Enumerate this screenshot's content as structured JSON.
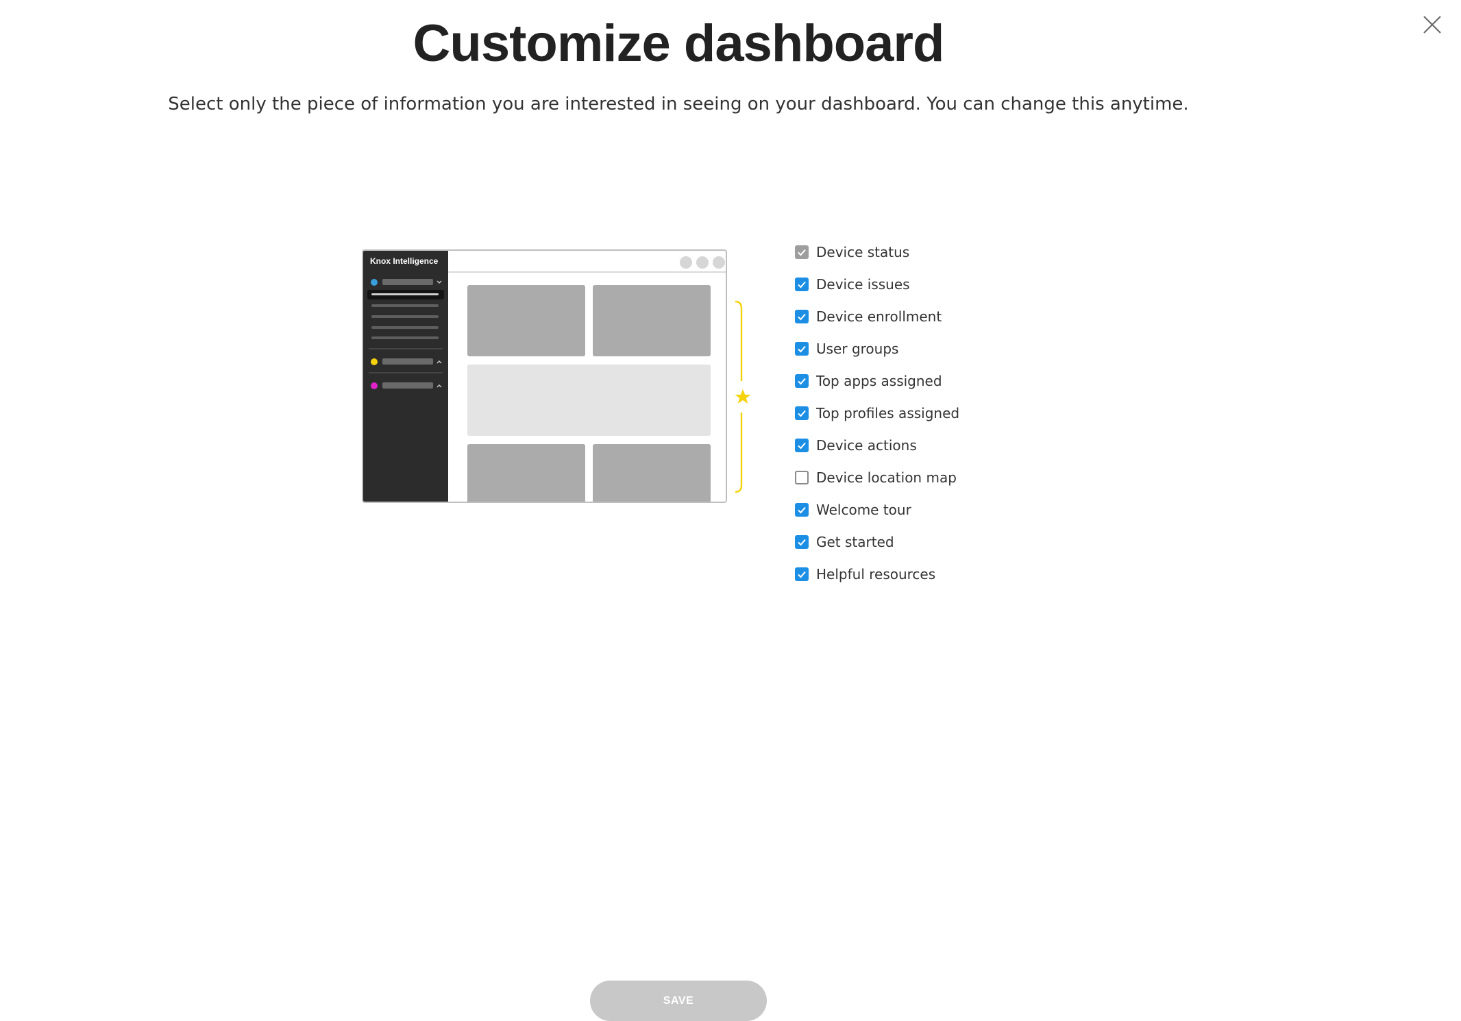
{
  "dialog": {
    "title": "Customize dashboard",
    "subtitle": "Select only the piece of information you are interested in seeing on your dashboard. You can change this anytime.",
    "close_icon": "close-icon"
  },
  "illustration": {
    "brand_label": "Knox Intelligence",
    "accent_colors": {
      "blue": "#3aa0dc",
      "yellow": "#f5d20a",
      "magenta": "#e023c8",
      "star": "#f5d20a"
    }
  },
  "options": [
    {
      "label": "Device status",
      "state": "checked-disabled"
    },
    {
      "label": "Device issues",
      "state": "checked"
    },
    {
      "label": "Device enrollment",
      "state": "checked"
    },
    {
      "label": "User groups",
      "state": "checked"
    },
    {
      "label": "Top apps assigned",
      "state": "checked"
    },
    {
      "label": "Top profiles assigned",
      "state": "checked"
    },
    {
      "label": "Device actions",
      "state": "checked"
    },
    {
      "label": "Device location map",
      "state": "unchecked"
    },
    {
      "label": "Welcome tour",
      "state": "checked"
    },
    {
      "label": "Get started",
      "state": "checked"
    },
    {
      "label": "Helpful resources",
      "state": "checked"
    }
  ],
  "footer": {
    "save_label": "SAVE"
  },
  "colors": {
    "check_accent": "#1c8fe5",
    "check_disabled": "#9e9e9e",
    "save_disabled_bg": "#c8c8c8"
  }
}
